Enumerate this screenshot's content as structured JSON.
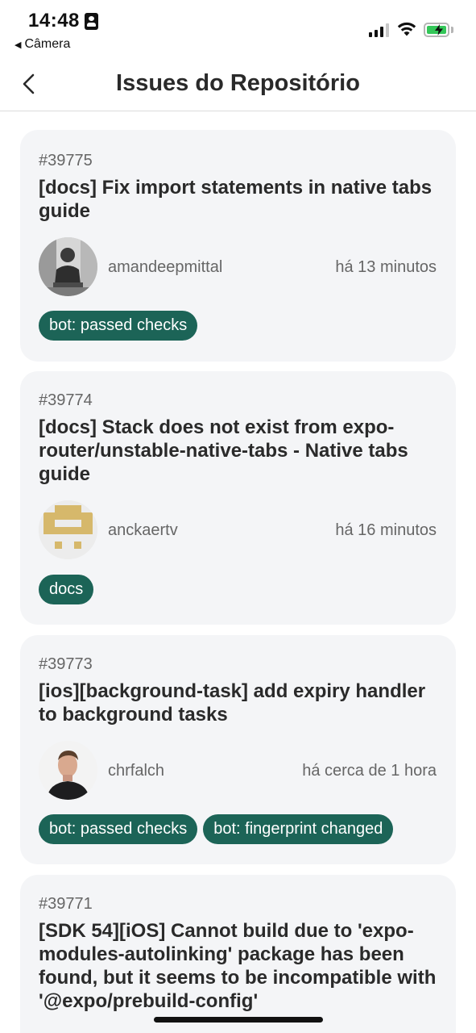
{
  "status_bar": {
    "time": "14:48",
    "back_app": "Câmera"
  },
  "nav": {
    "title": "Issues do Repositório"
  },
  "issues": [
    {
      "number": "#39775",
      "title": "[docs] Fix import statements in native tabs guide",
      "author": "amandeepmittal",
      "time_ago": "há 13 minutos",
      "labels": [
        "bot: passed checks"
      ]
    },
    {
      "number": "#39774",
      "title": "[docs] Stack does not exist from expo-router/unstable-native-tabs - Native tabs guide",
      "author": "anckaertv",
      "time_ago": "há 16 minutos",
      "labels": [
        "docs"
      ]
    },
    {
      "number": "#39773",
      "title": "[ios][background-task] add expiry handler to background tasks",
      "author": "chrfalch",
      "time_ago": "há cerca de 1 hora",
      "labels": [
        "bot: passed checks",
        "bot: fingerprint changed"
      ]
    },
    {
      "number": "#39771",
      "title": "[SDK 54][iOS] Cannot build due to 'expo-modules-autolinking' package has been found, but it seems to be incompatible with '@expo/prebuild-config'",
      "author": "",
      "time_ago": "",
      "labels": []
    }
  ],
  "colors": {
    "label_bg": "#1c6457",
    "card_bg": "#f4f5f7",
    "battery": "#34c759"
  }
}
